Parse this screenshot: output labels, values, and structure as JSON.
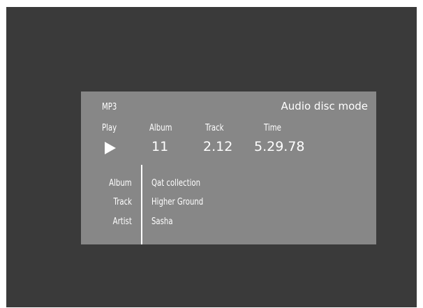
{
  "status": {
    "format": "MP3",
    "mode": "Audio disc mode",
    "state": "Play",
    "icon": "play-icon"
  },
  "columns": {
    "album_label": "Album",
    "track_label": "Track",
    "time_label": "Time",
    "album_value": "11",
    "track_value": "2.12",
    "time_value": "5.29.78"
  },
  "info": {
    "album_label": "Album",
    "track_label": "Track",
    "artist_label": "Artist",
    "album_value": "Qat collection",
    "track_value": "Higher Ground",
    "artist_value": "Sasha"
  },
  "colors": {
    "screen_bg": "#3a3a3a",
    "panel_bg": "#878787",
    "text": "#ffffff"
  }
}
